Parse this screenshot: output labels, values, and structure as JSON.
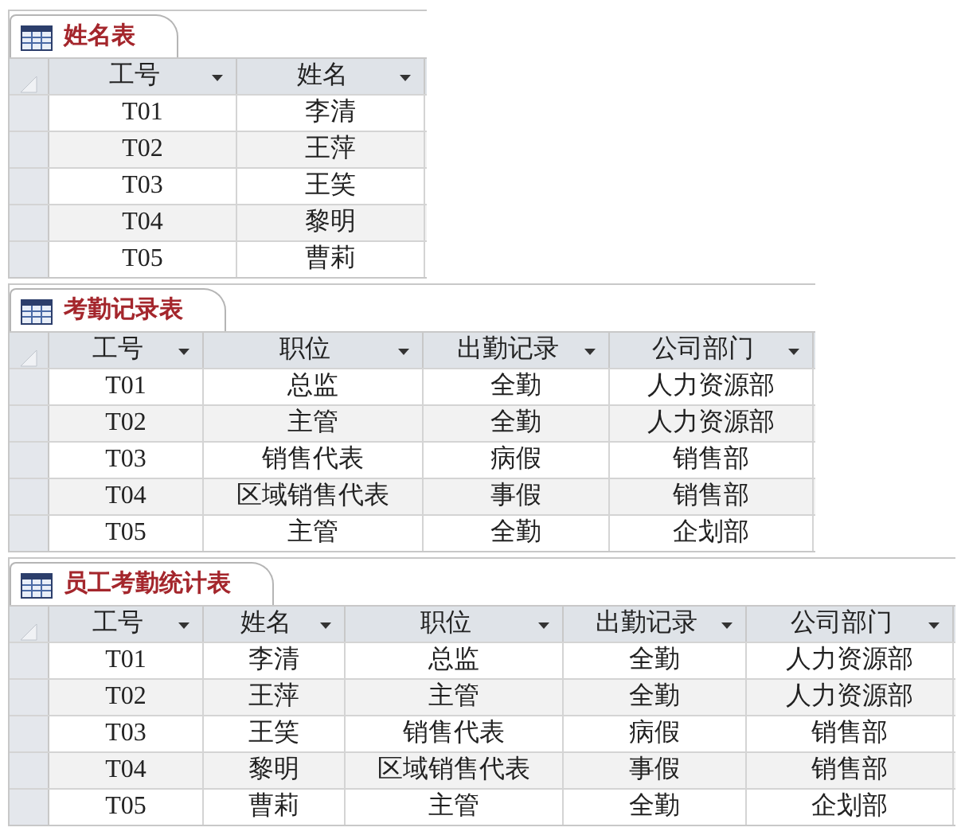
{
  "tables": [
    {
      "title": "姓名表",
      "columns": [
        "工号",
        "姓名"
      ],
      "rows": [
        [
          "T01",
          "李清"
        ],
        [
          "T02",
          "王萍"
        ],
        [
          "T03",
          "王笑"
        ],
        [
          "T04",
          "黎明"
        ],
        [
          "T05",
          "曹莉"
        ]
      ]
    },
    {
      "title": "考勤记录表",
      "columns": [
        "工号",
        "职位",
        "出勤记录",
        "公司部门"
      ],
      "rows": [
        [
          "T01",
          "总监",
          "全勤",
          "人力资源部"
        ],
        [
          "T02",
          "主管",
          "全勤",
          "人力资源部"
        ],
        [
          "T03",
          "销售代表",
          "病假",
          "销售部"
        ],
        [
          "T04",
          "区域销售代表",
          "事假",
          "销售部"
        ],
        [
          "T05",
          "主管",
          "全勤",
          "企划部"
        ]
      ]
    },
    {
      "title": "员工考勤统计表",
      "columns": [
        "工号",
        "姓名",
        "职位",
        "出勤记录",
        "公司部门"
      ],
      "rows": [
        [
          "T01",
          "李清",
          "总监",
          "全勤",
          "人力资源部"
        ],
        [
          "T02",
          "王萍",
          "主管",
          "全勤",
          "人力资源部"
        ],
        [
          "T03",
          "王笑",
          "销售代表",
          "病假",
          "销售部"
        ],
        [
          "T04",
          "黎明",
          "区域销售代表",
          "事假",
          "销售部"
        ],
        [
          "T05",
          "曹莉",
          "主管",
          "全勤",
          "企划部"
        ]
      ]
    }
  ]
}
